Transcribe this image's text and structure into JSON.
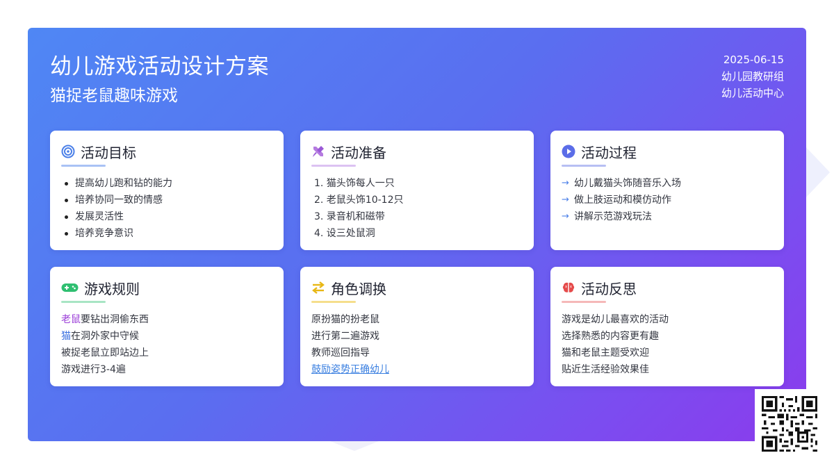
{
  "header": {
    "title": "幼儿游戏活动设计方案",
    "subtitle": "猫捉老鼠趣味游戏",
    "date": "2025-06-15",
    "org": "幼儿园教研组",
    "center": "幼儿活动中心"
  },
  "colors": {
    "goal_accent": "#4a7fe8",
    "prep_accent": "#b57be0",
    "process_accent": "#5b6de8",
    "rules_accent": "#2fbf71",
    "swap_accent": "#e8b714",
    "reflect_accent": "#e54b4b"
  },
  "cards": {
    "goal": {
      "icon": "target-icon",
      "title": "活动目标",
      "items": [
        "提高幼儿跑和钻的能力",
        "培养协同一致的情感",
        "发展灵活性",
        "培养竞争意识"
      ]
    },
    "prep": {
      "icon": "tools-icon",
      "title": "活动准备",
      "items": [
        "1. 猫头饰每人一只",
        "2. 老鼠头饰10-12只",
        "3. 录音机和磁带",
        "4. 设三处鼠洞"
      ]
    },
    "process": {
      "icon": "play-icon",
      "title": "活动过程",
      "items": [
        "幼儿戴猫头饰随音乐入场",
        "做上肢运动和模仿动作",
        "讲解示范游戏玩法"
      ]
    },
    "rules": {
      "icon": "gamepad-icon",
      "title": "游戏规则",
      "item1_hl": "老鼠",
      "item1_rest": "要钻出洞偷东西",
      "item2_hl": "猫",
      "item2_rest": "在洞外家中守候",
      "item3": "被捉老鼠立即站边上",
      "item4": "游戏进行3-4遍"
    },
    "swap": {
      "icon": "swap-arrows-icon",
      "title": "角色调换",
      "item1": "原扮猫的扮老鼠",
      "item2": "进行第二遍游戏",
      "item3": "教师巡回指导",
      "item4": "鼓励姿势正确幼儿"
    },
    "reflect": {
      "icon": "brain-icon",
      "title": "活动反思",
      "item1": "游戏是幼儿最喜欢的活动",
      "item2": "选择熟悉的内容更有趣",
      "item3": "猫和老鼠主题受欢迎",
      "item4": "贴近生活经验效果佳"
    }
  },
  "qr_icon": "qr-code-icon"
}
